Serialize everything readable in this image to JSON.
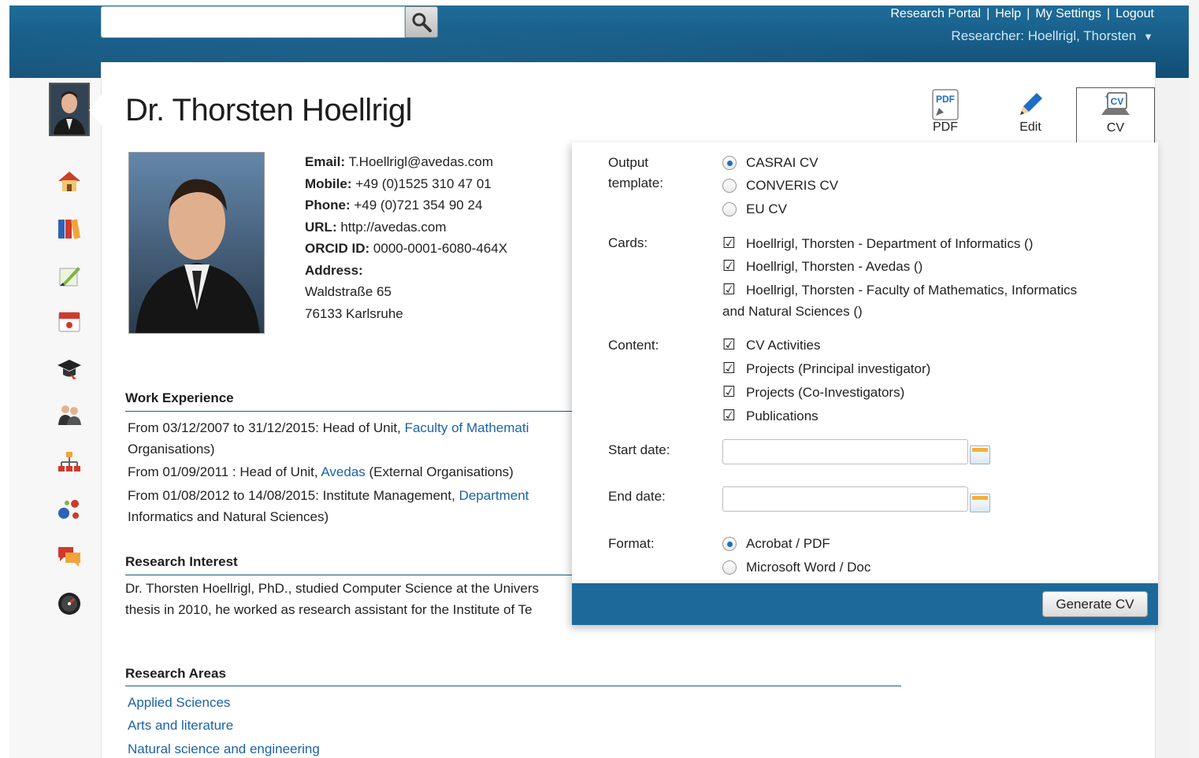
{
  "header": {
    "search": {
      "placeholder": "",
      "value": ""
    },
    "links": [
      "Research Portal",
      "Help",
      "My Settings",
      "Logout"
    ],
    "researcher": "Researcher: Hoellrigl, Thorsten"
  },
  "sidebar": {
    "items": [
      {
        "icon": "home-icon"
      },
      {
        "icon": "books-icon"
      },
      {
        "icon": "document-pen-icon"
      },
      {
        "icon": "calendar-icon"
      },
      {
        "icon": "graduation-cap-icon"
      },
      {
        "icon": "people-icon"
      },
      {
        "icon": "org-chart-icon"
      },
      {
        "icon": "network-icon"
      },
      {
        "icon": "chat-bubbles-icon"
      },
      {
        "icon": "dashboard-gauge-icon"
      }
    ]
  },
  "profile": {
    "name": "Dr. Thorsten Hoellrigl",
    "contact": {
      "email_label": "Email:",
      "email": "T.Hoellrigl@avedas.com",
      "mobile_label": "Mobile:",
      "mobile": "+49 (0)1525 310 47 01",
      "phone_label": "Phone:",
      "phone": "+49 (0)721 354 90 24",
      "url_label": "URL:",
      "url": "http://avedas.com",
      "orcid_label": "ORCID ID:",
      "orcid": "0000-0001-6080-464X",
      "address_label": "Address:",
      "address_line1": "Waldstraße 65",
      "address_line2": "76133 Karlsruhe"
    }
  },
  "toolbar": {
    "pdf_label": "PDF",
    "edit_label": "Edit",
    "cv_label": "CV",
    "pdf_icon_text": "PDF",
    "cv_icon_text": "CV"
  },
  "work_experience": {
    "title": "Work Experience",
    "lines": [
      {
        "prefix": "From 03/12/2007 to 31/12/2015: Head of Unit, ",
        "link": "Faculty of Mathemati",
        "suffix": ""
      },
      {
        "prefix": "Organisations)",
        "link": "",
        "suffix": ""
      },
      {
        "prefix": "From 01/09/2011 : Head of Unit, ",
        "link": "Avedas",
        "suffix": " (External Organisations)"
      },
      {
        "prefix": "From 01/08/2012 to 14/08/2015: Institute Management, ",
        "link": "Department",
        "suffix": ""
      },
      {
        "prefix": "Informatics and Natural Sciences)",
        "link": "",
        "suffix": ""
      }
    ]
  },
  "research_interest": {
    "title": "Research Interest",
    "lines": [
      "Dr. Thorsten Hoellrigl, PhD., studied Computer Science at the Univers",
      "thesis in 2010, he worked as research assistant for the Institute of Te"
    ]
  },
  "research_areas": {
    "title": "Research Areas",
    "items": [
      "Applied Sciences",
      "Arts and literature",
      "Natural science and engineering"
    ]
  },
  "cv_panel": {
    "output_label_1": "Output",
    "output_label_2": "template:",
    "templates": [
      {
        "label": "CASRAI CV",
        "selected": true
      },
      {
        "label": "CONVERIS CV",
        "selected": false
      },
      {
        "label": "EU CV",
        "selected": false
      }
    ],
    "cards_label": "Cards:",
    "cards": [
      "Hoellrigl, Thorsten - Department of Informatics ()",
      "Hoellrigl, Thorsten - Avedas ()",
      "Hoellrigl, Thorsten - Faculty of Mathematics, Informatics"
    ],
    "cards_wrap": "and Natural Sciences ()",
    "content_label": "Content:",
    "content": [
      "CV Activities",
      "Projects (Principal investigator)",
      "Projects (Co-Investigators)",
      "Publications"
    ],
    "start_label": "Start date:",
    "start_value": "",
    "end_label": "End date:",
    "end_value": "",
    "format_label": "Format:",
    "formats": [
      {
        "label": "Acrobat / PDF",
        "selected": true
      },
      {
        "label": "Microsoft Word / Doc",
        "selected": false
      }
    ],
    "generate_label": "Generate CV"
  }
}
